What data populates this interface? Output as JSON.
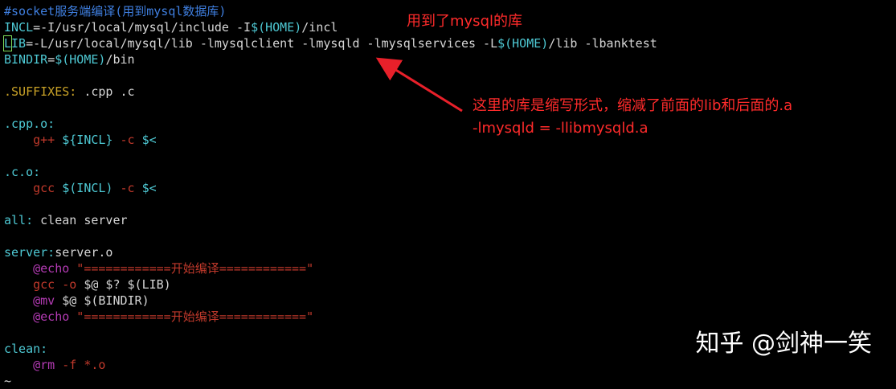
{
  "lines": [
    [
      {
        "t": "#socket服务端编译(用到mysql数据库)",
        "c": "comment"
      }
    ],
    [
      {
        "t": "INCL",
        "c": "var"
      },
      {
        "t": "=-I/usr/local/mysql/include -I",
        "c": "plain"
      },
      {
        "t": "$(HOME)",
        "c": "var"
      },
      {
        "t": "/incl",
        "c": "plain"
      }
    ],
    [
      {
        "t": "L",
        "c": "cursor"
      },
      {
        "t": "IB",
        "c": "var"
      },
      {
        "t": "=-L/usr/local/mysql/lib -lmysqlclient -lmysqld -lmysqlservices -L",
        "c": "plain"
      },
      {
        "t": "$(HOME)",
        "c": "var"
      },
      {
        "t": "/lib -lbanktest",
        "c": "plain"
      }
    ],
    [
      {
        "t": "BINDIR",
        "c": "var"
      },
      {
        "t": "=",
        "c": "plain"
      },
      {
        "t": "$(HOME)",
        "c": "var"
      },
      {
        "t": "/bin",
        "c": "plain"
      }
    ],
    [],
    [
      {
        "t": ".SUFFIXES:",
        "c": "key"
      },
      {
        "t": " .cpp .c",
        "c": "plain"
      }
    ],
    [],
    [
      {
        "t": ".cpp.o:",
        "c": "target"
      }
    ],
    [
      {
        "t": "    ",
        "c": "plain"
      },
      {
        "t": "g++",
        "c": "cmd"
      },
      {
        "t": " ",
        "c": "plain"
      },
      {
        "t": "${INCL}",
        "c": "var"
      },
      {
        "t": " ",
        "c": "plain"
      },
      {
        "t": "-c",
        "c": "cmd"
      },
      {
        "t": " ",
        "c": "plain"
      },
      {
        "t": "$<",
        "c": "var"
      }
    ],
    [],
    [
      {
        "t": ".c.o:",
        "c": "target"
      }
    ],
    [
      {
        "t": "    ",
        "c": "plain"
      },
      {
        "t": "gcc",
        "c": "cmd"
      },
      {
        "t": " ",
        "c": "plain"
      },
      {
        "t": "$(INCL)",
        "c": "var"
      },
      {
        "t": " ",
        "c": "plain"
      },
      {
        "t": "-c",
        "c": "cmd"
      },
      {
        "t": " ",
        "c": "plain"
      },
      {
        "t": "$<",
        "c": "var"
      }
    ],
    [],
    [
      {
        "t": "all:",
        "c": "target"
      },
      {
        "t": " clean server",
        "c": "plain"
      }
    ],
    [],
    [
      {
        "t": "server:",
        "c": "target"
      },
      {
        "t": "server.o",
        "c": "plain"
      }
    ],
    [
      {
        "t": "    ",
        "c": "plain"
      },
      {
        "t": "@echo",
        "c": "echo"
      },
      {
        "t": " \"============开始编译============\"",
        "c": "str"
      }
    ],
    [
      {
        "t": "    ",
        "c": "plain"
      },
      {
        "t": "gcc",
        "c": "cmd"
      },
      {
        "t": " ",
        "c": "plain"
      },
      {
        "t": "-o",
        "c": "cmd"
      },
      {
        "t": " $@ $? $(LIB)",
        "c": "plain"
      }
    ],
    [
      {
        "t": "    ",
        "c": "plain"
      },
      {
        "t": "@mv",
        "c": "echo"
      },
      {
        "t": " $@ $(BINDIR)",
        "c": "plain"
      }
    ],
    [
      {
        "t": "    ",
        "c": "plain"
      },
      {
        "t": "@echo",
        "c": "echo"
      },
      {
        "t": " \"============开始编译============\"",
        "c": "str"
      }
    ],
    [],
    [
      {
        "t": "clean:",
        "c": "target"
      }
    ],
    [
      {
        "t": "    ",
        "c": "plain"
      },
      {
        "t": "@rm",
        "c": "echo"
      },
      {
        "t": " -f *.o",
        "c": "str"
      }
    ],
    [
      {
        "t": "~",
        "c": "tilde"
      }
    ]
  ],
  "annotations": {
    "note1": "用到了mysql的库",
    "note2_line1": "这里的库是缩写形式，缩减了前面的lib和后面的.a",
    "note2_line2": "-lmysqld = -llibmysqld.a"
  },
  "watermark": "知乎 @剑神一笑",
  "colors": {
    "annotation": "#ff2b2b",
    "arrow": "#e8202a"
  }
}
